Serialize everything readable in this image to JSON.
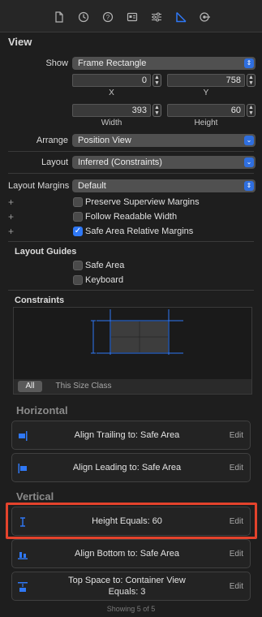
{
  "toolbar": {
    "icons": [
      "file-inspector-icon",
      "history-icon",
      "help-icon",
      "identity-icon",
      "attributes-icon",
      "size-inspector-icon",
      "connections-icon"
    ],
    "active": "size-inspector-icon",
    "accent": "#2f78f6"
  },
  "view": {
    "title": "View",
    "show_label": "Show",
    "show_value": "Frame Rectangle",
    "x_value": "0",
    "y_value": "758",
    "x_label": "X",
    "y_label": "Y",
    "width_value": "393",
    "height_value": "60",
    "width_label": "Width",
    "height_label": "Height",
    "arrange_label": "Arrange",
    "arrange_value": "Position View",
    "layout_label": "Layout",
    "layout_value": "Inferred (Constraints)",
    "layout_margins_label": "Layout Margins",
    "layout_margins_value": "Default",
    "options": [
      {
        "label": "Preserve Superview Margins",
        "checked": false
      },
      {
        "label": "Follow Readable Width",
        "checked": false
      },
      {
        "label": "Safe Area Relative Margins",
        "checked": true
      }
    ]
  },
  "layout_guides": {
    "title": "Layout Guides",
    "items": [
      {
        "label": "Safe Area",
        "checked": false
      },
      {
        "label": "Keyboard",
        "checked": false
      }
    ]
  },
  "constraints": {
    "title": "Constraints",
    "filter_all": "All",
    "filter_size_class": "This Size Class"
  },
  "horizontal": {
    "title": "Horizontal",
    "rows": [
      {
        "text": "Align Trailing to:  Safe Area",
        "edit": "Edit"
      },
      {
        "text": "Align Leading to:  Safe Area",
        "edit": "Edit"
      }
    ]
  },
  "vertical": {
    "title": "Vertical",
    "rows": [
      {
        "text": "Height Equals:  60",
        "edit": "Edit"
      },
      {
        "text": "Align Bottom to:  Safe Area",
        "edit": "Edit"
      },
      {
        "text": "Top Space to:  Container View\nEquals:  3",
        "edit": "Edit"
      }
    ]
  },
  "footer": {
    "showing": "Showing 5 of 5"
  },
  "colors": {
    "highlight": "#e4432c"
  }
}
